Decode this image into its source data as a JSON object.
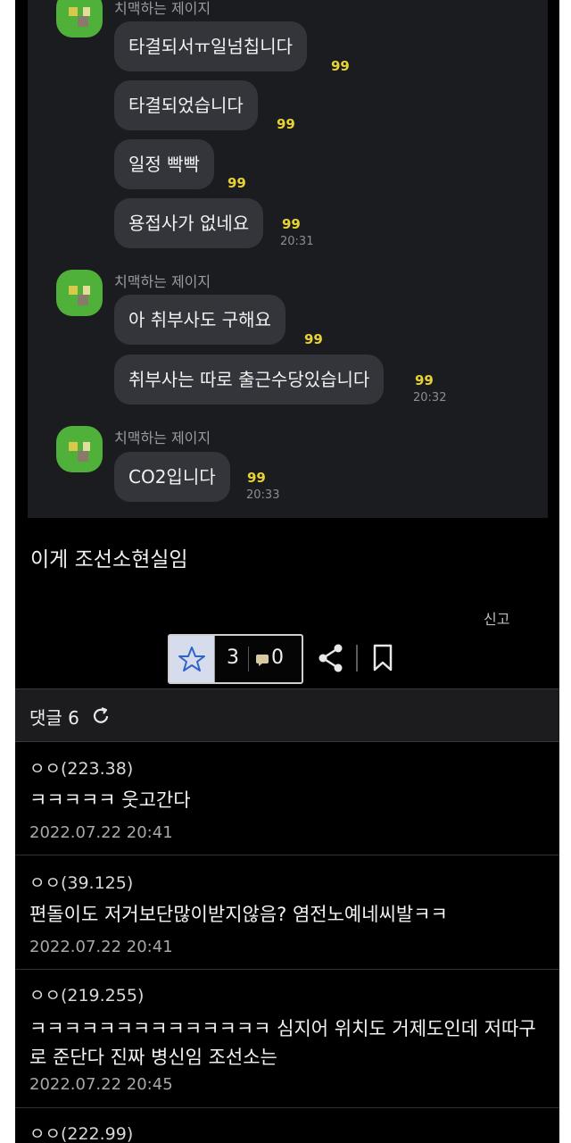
{
  "chat": {
    "groups": [
      {
        "sender": "치맥하는 제이지",
        "messages": [
          {
            "text": "타결되서ㅠ일넘칩니다",
            "badge": "99",
            "time": ""
          },
          {
            "text": "타결되었습니다",
            "badge": "99",
            "time": ""
          },
          {
            "text": "일정 빡빡",
            "badge": "99",
            "time": ""
          },
          {
            "text": "용접사가 없네요",
            "badge": "99",
            "time": "20:31"
          }
        ]
      },
      {
        "sender": "치맥하는 제이지",
        "messages": [
          {
            "text": "아 취부사도 구해요",
            "badge": "99",
            "time": ""
          },
          {
            "text": "취부사는 따로 출근수당있습니다",
            "badge": "99",
            "time": "20:32"
          }
        ]
      },
      {
        "sender": "치맥하는 제이지",
        "messages": [
          {
            "text": "CO2입니다",
            "badge": "99",
            "time": "20:33"
          }
        ]
      }
    ]
  },
  "post": {
    "body": "이게 조선소현실임",
    "report_label": "신고"
  },
  "actions": {
    "recommend_count": "3",
    "comment_count": "0",
    "icons": [
      "star-icon",
      "comment-icon",
      "share-icon",
      "bookmark-icon"
    ]
  },
  "comments": {
    "header_label": "댓글 6",
    "items": [
      {
        "author": "ㅇㅇ(223.38)",
        "text": "ㅋㅋㅋㅋㅋ 웃고간다",
        "date": "2022.07.22 20:41"
      },
      {
        "author": "ㅇㅇ(39.125)",
        "text": "편돌이도 저거보단많이받지않음? 염전노예네씨발ㅋㅋ",
        "date": "2022.07.22 20:41"
      },
      {
        "author": "ㅇㅇ(219.255)",
        "text": "ㅋㅋㅋㅋㅋㅋㅋㅋㅋㅋㅋㅋㅋㅋ 심지어 위치도 거제도인데 저따구로 준단다 진짜 병신임 조선소는",
        "date": "2022.07.22 20:45"
      },
      {
        "author": "ㅇㅇ(222.99)",
        "text": "",
        "date": ""
      }
    ]
  },
  "colors": {
    "chat_bg": "#1b1c20",
    "bubble": "#34353a",
    "badge": "#e8d334",
    "avatar": "#4fb13a"
  }
}
